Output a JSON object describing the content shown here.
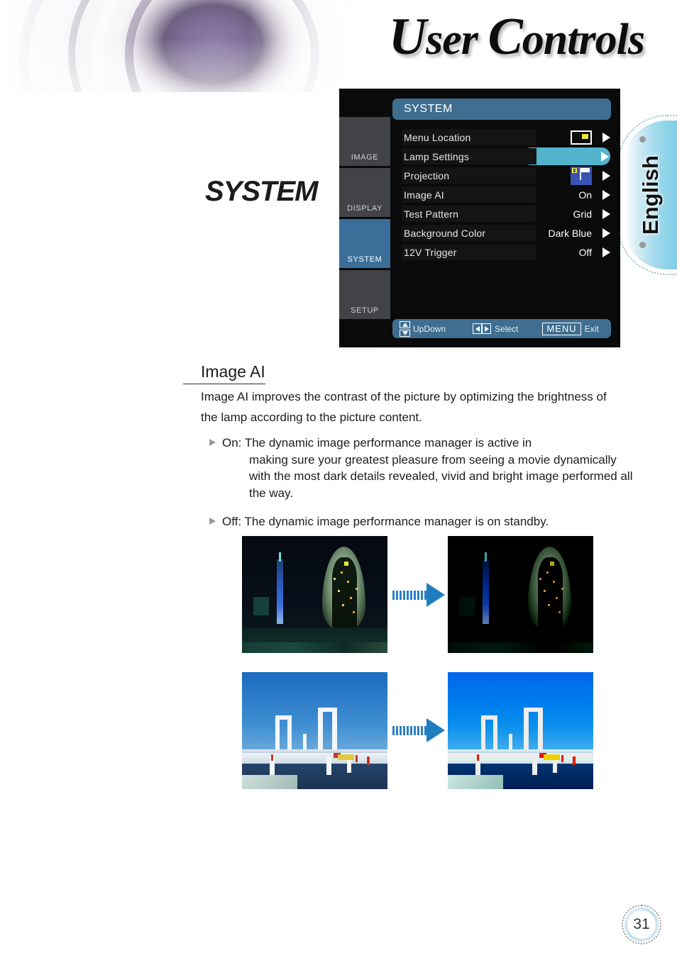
{
  "header": {
    "title_part1": "U",
    "title_rest1": "ser ",
    "title_part2": "C",
    "title_rest2": "ontrols",
    "title_full": "User Controls"
  },
  "language_tab": {
    "label": "English"
  },
  "section": {
    "title": "SYSTEM"
  },
  "osd": {
    "title": "SYSTEM",
    "side_tabs": [
      {
        "label": "IMAGE",
        "active": false
      },
      {
        "label": "DISPLAY",
        "active": false
      },
      {
        "label": "SYSTEM",
        "active": true
      },
      {
        "label": "SETUP",
        "active": false
      }
    ],
    "rows": [
      {
        "label": "Menu Location",
        "value": "",
        "value_icon": "menu-location-icon",
        "highlighted": false
      },
      {
        "label": "Lamp Settings",
        "value": "",
        "value_icon": "",
        "highlighted": true
      },
      {
        "label": "Projection",
        "value": "",
        "value_icon": "projection-icon",
        "highlighted": false
      },
      {
        "label": "Image AI",
        "value": "On",
        "value_icon": "",
        "highlighted": false
      },
      {
        "label": "Test Pattern",
        "value": "Grid",
        "value_icon": "",
        "highlighted": false
      },
      {
        "label": "Background Color",
        "value": "Dark Blue",
        "value_icon": "",
        "highlighted": false
      },
      {
        "label": "12V Trigger",
        "value": "Off",
        "value_icon": "",
        "highlighted": false
      }
    ],
    "footer": {
      "updown_label": "UpDown",
      "select_label": "Select",
      "menu_label": "MENU",
      "exit_label": "Exit"
    },
    "colors": {
      "title_bar": "#3f6e90",
      "highlight": "#52b3cd",
      "active_tab": "#3b6f99",
      "tab": "#414347",
      "background": "#0a0a0a"
    }
  },
  "content": {
    "sub_heading": "Image AI",
    "paragraph": "Image AI improves the contrast of the picture by optimizing the brightness of the lamp according to the picture content.",
    "bullets": [
      {
        "lead": "On: The dynamic image performance manager is active in",
        "cont": "making sure your greatest pleasure from seeing a movie dynamically with the most dark details revealed, vivid and bright image performed all the way."
      },
      {
        "lead": "Off: The dynamic image performance manager is on standby.",
        "cont": ""
      }
    ]
  },
  "figures": [
    {
      "name": "night-city-before",
      "caption": ""
    },
    {
      "name": "night-city-after",
      "caption": ""
    },
    {
      "name": "bridge-before",
      "caption": ""
    },
    {
      "name": "bridge-after",
      "caption": ""
    }
  ],
  "page": {
    "number": "31"
  }
}
